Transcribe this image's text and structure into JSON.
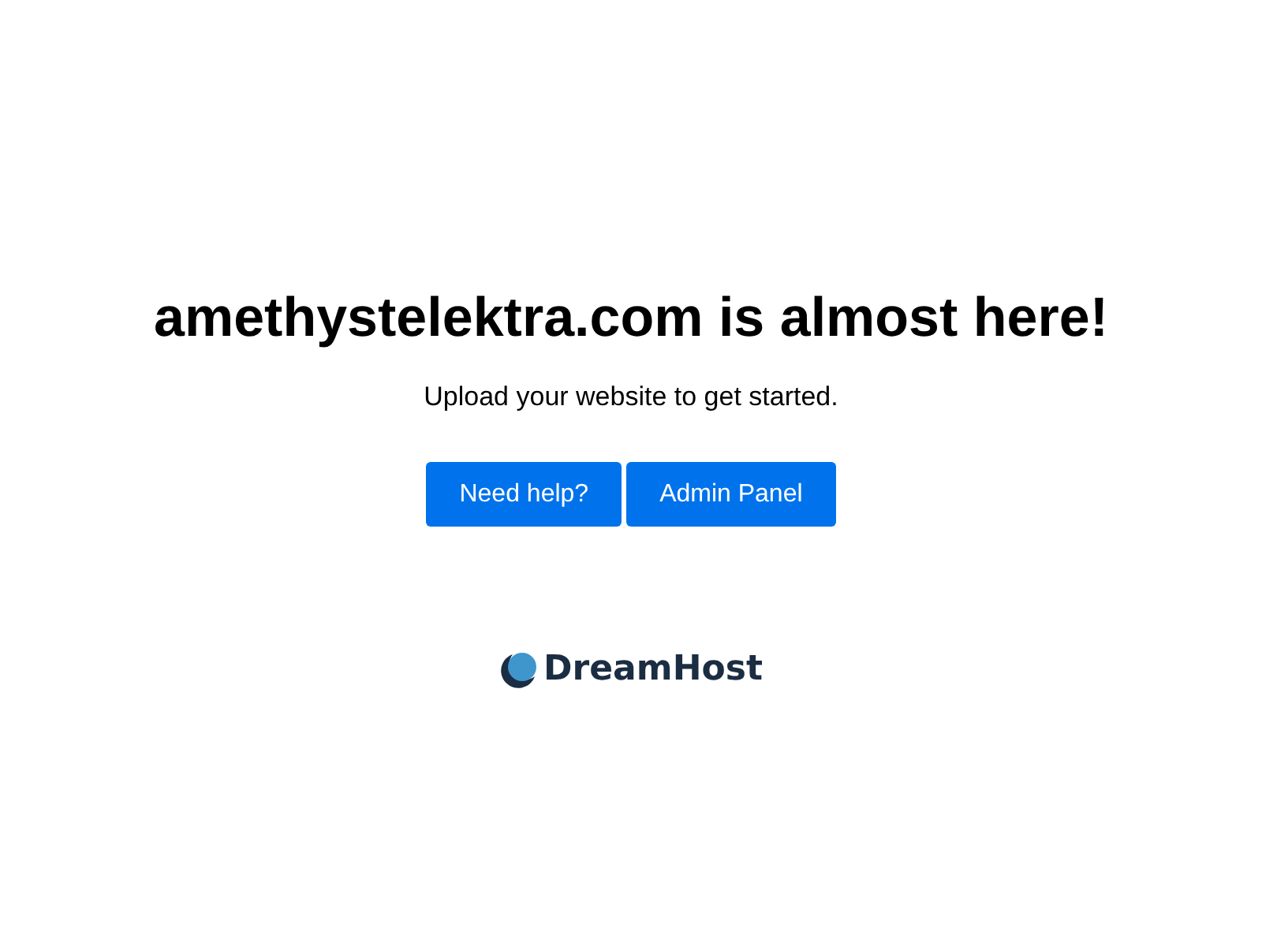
{
  "heading": "amethystelektra.com is almost here!",
  "subheading": "Upload your website to get started.",
  "buttons": [
    "Need help?",
    "Admin Panel"
  ],
  "logo": {
    "text": "DreamHost"
  }
}
